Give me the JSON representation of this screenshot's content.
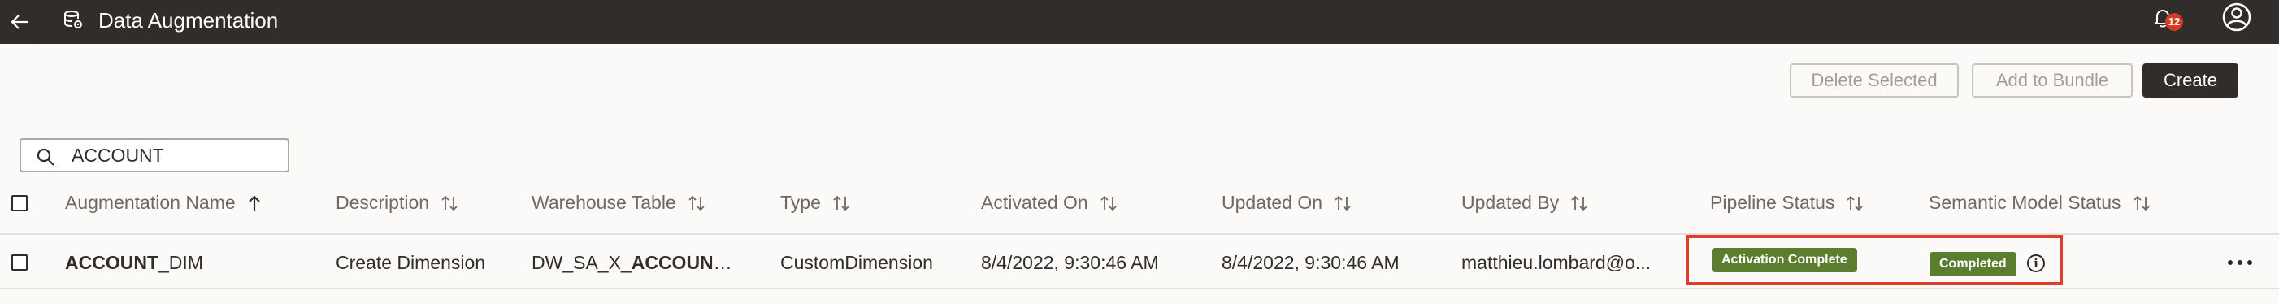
{
  "header": {
    "title": "Data Augmentation",
    "back_icon": "arrow-left-icon",
    "app_icon": "database-gear-icon",
    "notification_icon": "bell-icon",
    "notification_count": "12",
    "avatar_icon": "user-circle-icon"
  },
  "toolbar": {
    "delete_label": "Delete Selected",
    "bundle_label": "Add to Bundle",
    "create_label": "Create"
  },
  "search": {
    "value": "ACCOUNT",
    "icon": "search-icon"
  },
  "table": {
    "columns": [
      {
        "label": "Augmentation Name",
        "sort": "ascending"
      },
      {
        "label": "Description",
        "sort": "sortable"
      },
      {
        "label": "Warehouse Table",
        "sort": "sortable"
      },
      {
        "label": "Type",
        "sort": "sortable"
      },
      {
        "label": "Activated On",
        "sort": "sortable"
      },
      {
        "label": "Updated On",
        "sort": "sortable"
      },
      {
        "label": "Updated By",
        "sort": "sortable"
      },
      {
        "label": "Pipeline Status",
        "sort": "sortable"
      },
      {
        "label": "Semantic Model Status",
        "sort": "sortable"
      }
    ],
    "rows": [
      {
        "name_bold": "ACCOUNT",
        "name_rest": "_DIM",
        "description": "Create Dimension",
        "warehouse_prefix": "DW_SA_X_",
        "warehouse_bold": "ACCOUNT",
        "warehouse_suffix": "...",
        "type": "CustomDimension",
        "activated_on": "8/4/2022, 9:30:46 AM",
        "updated_on": "8/4/2022, 9:30:46 AM",
        "updated_by": "matthieu.lombard@o...",
        "pipeline_status": "Activation Complete",
        "semantic_model_status": "Completed",
        "info_icon": "info-circle-icon",
        "more_icon": "more-horizontal-icon"
      }
    ]
  },
  "colors": {
    "header_bg": "#312d2a",
    "status_badge": "#5b7e2e",
    "highlight_border": "#e03e2d",
    "notification_badge": "#d63b25"
  }
}
